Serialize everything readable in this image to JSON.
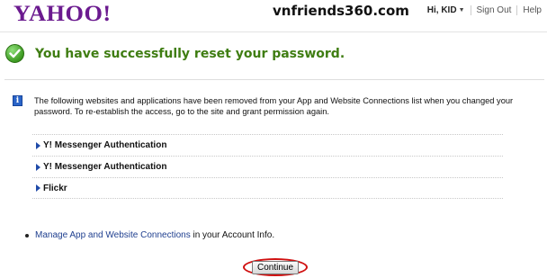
{
  "header": {
    "logo": "YAHOO!",
    "watermark": "vnfriends360.com",
    "user_greeting": "Hi, KID",
    "sign_out": "Sign Out",
    "help": "Help"
  },
  "success": {
    "message": "You have successfully reset your password."
  },
  "notice": {
    "text": "The following websites and applications have been removed from your App and Website Connections list when you changed your password. To re-establish the access, go to the site and grant permission again."
  },
  "connections": [
    {
      "label": "Y! Messenger Authentication"
    },
    {
      "label": "Y! Messenger Authentication"
    },
    {
      "label": "Flickr"
    }
  ],
  "manage": {
    "link_text": "Manage App and Website Connections",
    "suffix": " in your Account Info."
  },
  "continue_button": "Continue",
  "colors": {
    "brand": "#6b1a8f",
    "success_text": "#3f7d12",
    "link": "#1f3f8f",
    "annotation": "#d01010"
  }
}
